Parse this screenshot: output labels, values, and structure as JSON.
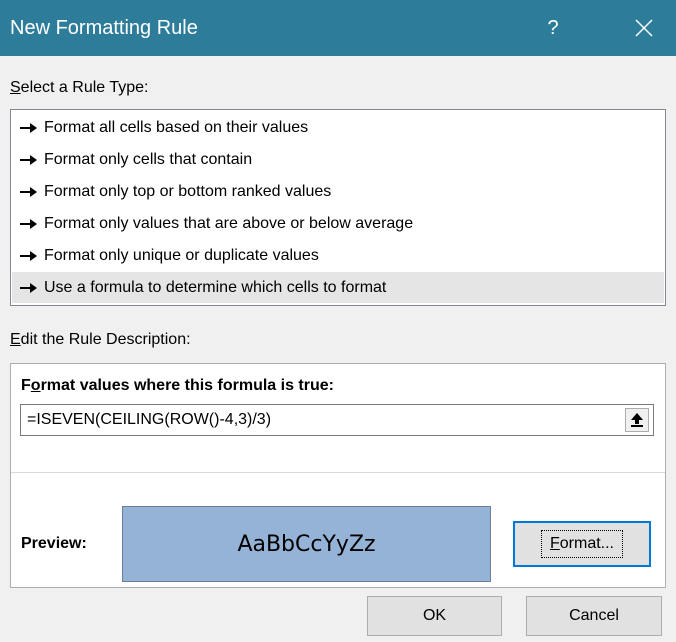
{
  "window": {
    "title": "New Formatting Rule",
    "help_label": "?",
    "close_icon": "close-icon",
    "title_bar_color": "#2d7d9a"
  },
  "rule_type": {
    "label_access": "S",
    "label_rest": "elect a Rule Type:",
    "items": [
      {
        "label": "Format all cells based on their values",
        "selected": false
      },
      {
        "label": "Format only cells that contain",
        "selected": false
      },
      {
        "label": "Format only top or bottom ranked values",
        "selected": false
      },
      {
        "label": "Format only values that are above or below average",
        "selected": false
      },
      {
        "label": "Format only unique or duplicate values",
        "selected": false
      },
      {
        "label": "Use a formula to determine which cells to format",
        "selected": true
      }
    ],
    "item_icon": "arrow-right-icon"
  },
  "description": {
    "label_access": "E",
    "label_rest": "dit the Rule Description:",
    "heading_pre": "F",
    "heading_access": "o",
    "heading_rest": "rmat values where this formula is true:",
    "formula": "=ISEVEN(CEILING(ROW()-4,3)/3)",
    "collapse_icon": "collapse-dialog-icon",
    "preview_label": "Preview:",
    "preview_text": "AaBbCcYyZz",
    "preview_fill_color": "#95b3d7",
    "format_button_access": "F",
    "format_button_rest": "ormat..."
  },
  "buttons": {
    "ok": "OK",
    "cancel": "Cancel"
  }
}
